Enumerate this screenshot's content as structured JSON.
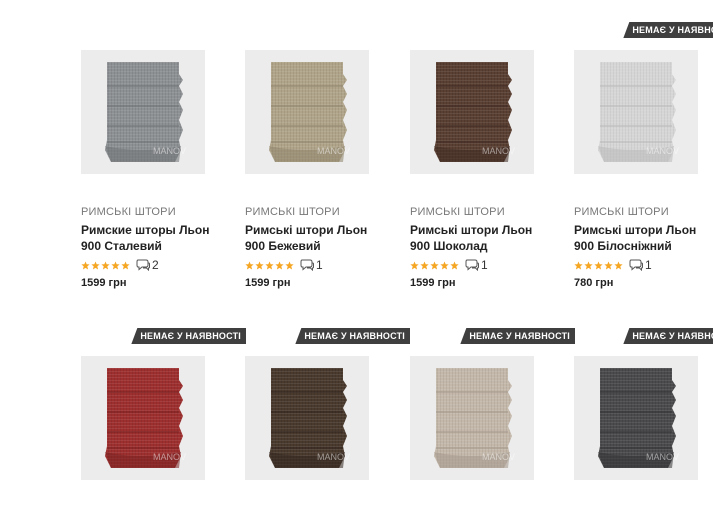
{
  "products": [
    {
      "badge": "",
      "category": "РИМСЬКІ ШТОРИ",
      "title": "Римские шторы Льон 900 Сталевий",
      "rating": 5,
      "reviews": "2",
      "price": "1599 грн",
      "color": "#8e9194",
      "color_dark": "#6f7275",
      "watermark": "MANOV"
    },
    {
      "badge": "",
      "category": "РИМСЬКІ ШТОРИ",
      "title": "Римські штори Льон 900 Бежевий",
      "rating": 5,
      "reviews": "1",
      "price": "1599 грн",
      "color": "#b0a58b",
      "color_dark": "#8f856c",
      "watermark": "MANOV"
    },
    {
      "badge": "",
      "category": "РИМСЬКІ ШТОРИ",
      "title": "Римські штори Льон 900 Шоколад",
      "rating": 5,
      "reviews": "1",
      "price": "1599 грн",
      "color": "#5a3f33",
      "color_dark": "#3f2b22",
      "watermark": "MANOV"
    },
    {
      "badge": "НЕМАЄ У НАЯВНОСТІ",
      "category": "РИМСЬКІ ШТОРИ",
      "title": "Римські штори Льон 900 Білосніжний",
      "rating": 5,
      "reviews": "1",
      "price": "780 грн",
      "color": "#d6d6d6",
      "color_dark": "#b9b9b9",
      "watermark": "MANOV"
    },
    {
      "badge": "НЕМАЄ У НАЯВНОСТІ",
      "category": "",
      "title": "",
      "rating": 0,
      "reviews": "",
      "price": "",
      "color": "#9e2f2f",
      "color_dark": "#7a2222",
      "watermark": "MANOV"
    },
    {
      "badge": "НЕМАЄ У НАЯВНОСТІ",
      "category": "",
      "title": "",
      "rating": 0,
      "reviews": "",
      "price": "",
      "color": "#4a3a2e",
      "color_dark": "#33271f",
      "watermark": "MANOV"
    },
    {
      "badge": "НЕМАЄ У НАЯВНОСТІ",
      "category": "",
      "title": "",
      "rating": 0,
      "reviews": "",
      "price": "",
      "color": "#c4b8ab",
      "color_dark": "#a3978a",
      "watermark": "MANOV"
    },
    {
      "badge": "НЕМАЄ У НАЯВНОСТІ",
      "category": "",
      "title": "",
      "rating": 0,
      "reviews": "",
      "price": "",
      "color": "#4b4b4d",
      "color_dark": "#343436",
      "watermark": "MANOV"
    }
  ],
  "colors": {
    "star": "#f5a623",
    "badge_bg": "#3f3f3f"
  }
}
